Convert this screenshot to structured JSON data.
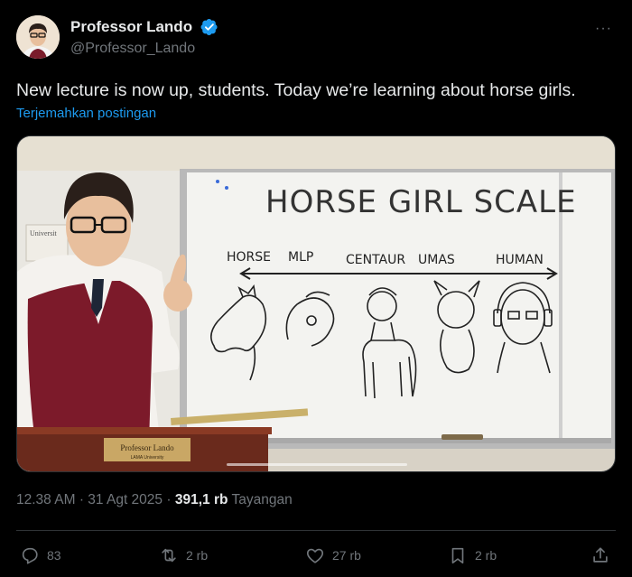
{
  "author": {
    "display_name": "Professor Lando",
    "handle": "@Professor_Lando",
    "avatar_icon": "avatar-photo",
    "verified_icon": "verified-badge-icon"
  },
  "more_label": "···",
  "tweet": {
    "text": "New lecture is now up, students. Today we’re learning about horse girls.",
    "translate_label": "Terjemahkan postingan"
  },
  "media": {
    "board_title": "HORSE GIRL SCALE",
    "scale_labels": [
      "HORSE",
      "MLP",
      "CENTAUR",
      "UMAS",
      "HUMAN"
    ],
    "nameplate_title": "Professor Lando",
    "nameplate_subtitle": "LAMA University",
    "side_sign": "Universit"
  },
  "meta": {
    "time": "12.38 AM",
    "separator": "·",
    "date": "31 Agt 2025",
    "views_count": "391,1 rb",
    "views_label": "Tayangan"
  },
  "actions": {
    "reply_count": "83",
    "repost_count": "2 rb",
    "like_count": "27 rb",
    "bookmark_count": "2 rb"
  },
  "colors": {
    "accent": "#1d9bf0",
    "muted": "#71767b",
    "text": "#e7e9ea",
    "background": "#000000"
  }
}
